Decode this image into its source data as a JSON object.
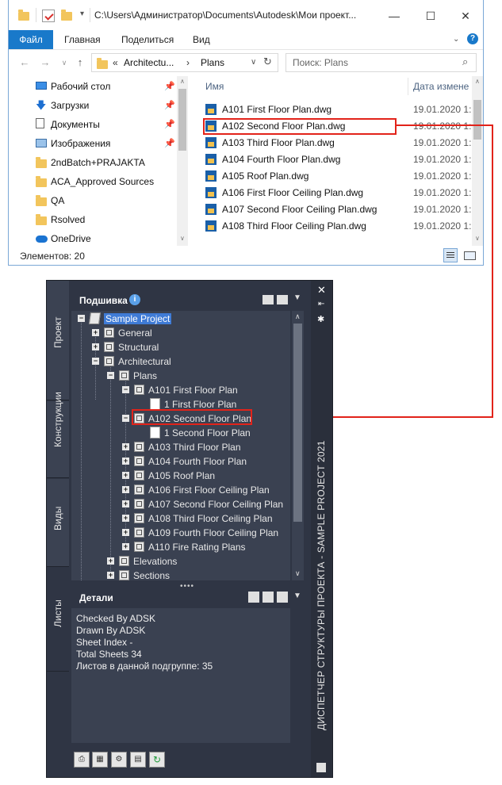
{
  "explorer": {
    "path": "C:\\Users\\Администратор\\Documents\\Autodesk\\Мои проект...",
    "window_controls": {
      "minimize": "—",
      "maximize": "☐",
      "close": "✕"
    },
    "ribbon": {
      "file": "Файл",
      "tabs": [
        "Главная",
        "Поделиться",
        "Вид"
      ]
    },
    "address": {
      "sep": "«",
      "crumbs": [
        "Architectu...",
        "Plans"
      ],
      "arrow": "›"
    },
    "search_placeholder": "Поиск: Plans",
    "nav_items": [
      {
        "label": "Рабочий стол",
        "icon": "desktop-icon",
        "pinned": true
      },
      {
        "label": "Загрузки",
        "icon": "download-icon",
        "pinned": true
      },
      {
        "label": "Документы",
        "icon": "document-icon",
        "pinned": true
      },
      {
        "label": "Изображения",
        "icon": "image-icon",
        "pinned": true
      },
      {
        "label": "2ndBatch+PRAJAKTA",
        "icon": "folder-icon",
        "pinned": false
      },
      {
        "label": "ACA_Approved Sources",
        "icon": "folder-icon",
        "pinned": false
      },
      {
        "label": "QA",
        "icon": "folder-icon",
        "pinned": false
      },
      {
        "label": "Rsolved",
        "icon": "folder-icon",
        "pinned": false
      },
      {
        "label": "OneDrive",
        "icon": "cloud-icon",
        "pinned": false
      }
    ],
    "columns": {
      "name": "Имя",
      "date": "Дата измене"
    },
    "files": [
      {
        "name": "A101 First Floor Plan.dwg",
        "date": "19.01.2020 1:"
      },
      {
        "name": "A102 Second Floor Plan.dwg",
        "date": "19.01.2020 1:",
        "highlight": true
      },
      {
        "name": "A103 Third Floor Plan.dwg",
        "date": "19.01.2020 1:"
      },
      {
        "name": "A104 Fourth Floor Plan.dwg",
        "date": "19.01.2020 1:"
      },
      {
        "name": "A105 Roof Plan.dwg",
        "date": "19.01.2020 1:"
      },
      {
        "name": "A106 First Floor Ceiling Plan.dwg",
        "date": "19.01.2020 1:"
      },
      {
        "name": "A107 Second Floor Ceiling Plan.dwg",
        "date": "19.01.2020 1:"
      },
      {
        "name": "A108 Third Floor Ceiling Plan.dwg",
        "date": "19.01.2020 1:"
      }
    ],
    "status": "Элементов: 20"
  },
  "palette": {
    "tabs": [
      "Проект",
      "Конструкции",
      "Виды",
      "Листы"
    ],
    "sheetset_title": "Подшивка",
    "tree": [
      {
        "label": "Sample Project",
        "level": 0,
        "exp": "−",
        "icon": "sheetset",
        "selected": true
      },
      {
        "label": "General",
        "level": 1,
        "exp": "+",
        "icon": "subset"
      },
      {
        "label": "Structural",
        "level": 1,
        "exp": "+",
        "icon": "subset"
      },
      {
        "label": "Architectural",
        "level": 1,
        "exp": "−",
        "icon": "subset"
      },
      {
        "label": "Plans",
        "level": 2,
        "exp": "−",
        "icon": "subset"
      },
      {
        "label": "A101 First Floor Plan",
        "level": 3,
        "exp": "−",
        "icon": "subset"
      },
      {
        "label": "1 First Floor Plan",
        "level": 4,
        "exp": "",
        "icon": "sheet"
      },
      {
        "label": "A102 Second Floor Plan",
        "level": 3,
        "exp": "−",
        "icon": "subset",
        "highlight": true
      },
      {
        "label": "1 Second Floor Plan",
        "level": 4,
        "exp": "",
        "icon": "sheet"
      },
      {
        "label": "A103 Third Floor Plan",
        "level": 3,
        "exp": "+",
        "icon": "subset"
      },
      {
        "label": "A104 Fourth Floor Plan",
        "level": 3,
        "exp": "+",
        "icon": "subset"
      },
      {
        "label": "A105 Roof Plan",
        "level": 3,
        "exp": "+",
        "icon": "subset"
      },
      {
        "label": "A106 First Floor Ceiling Plan",
        "level": 3,
        "exp": "+",
        "icon": "subset"
      },
      {
        "label": "A107 Second Floor Ceiling Plan",
        "level": 3,
        "exp": "+",
        "icon": "subset"
      },
      {
        "label": "A108 Third Floor Ceiling Plan",
        "level": 3,
        "exp": "+",
        "icon": "subset"
      },
      {
        "label": "A109 Fourth Floor Ceiling Plan",
        "level": 3,
        "exp": "+",
        "icon": "subset"
      },
      {
        "label": "A110 Fire Rating Plans",
        "level": 3,
        "exp": "+",
        "icon": "subset"
      },
      {
        "label": "Elevations",
        "level": 2,
        "exp": "+",
        "icon": "subset"
      },
      {
        "label": "Sections",
        "level": 2,
        "exp": "+",
        "icon": "subset"
      }
    ],
    "details_title": "Детали",
    "details": [
      "Checked By ADSK",
      "Drawn By ADSK",
      "Sheet Index -",
      "Total Sheets 34",
      "Листов в данной подгруппе: 35"
    ],
    "vertical_title": "ДИСПЕТЧЕР СТРУКТУРЫ ПРОЕКТА - SAMPLE PROJECT 2021",
    "colors": {
      "bg": "#2f3544",
      "panel": "#3a4151",
      "selected": "#3f7bd6",
      "accent_red": "#e2231a"
    }
  }
}
